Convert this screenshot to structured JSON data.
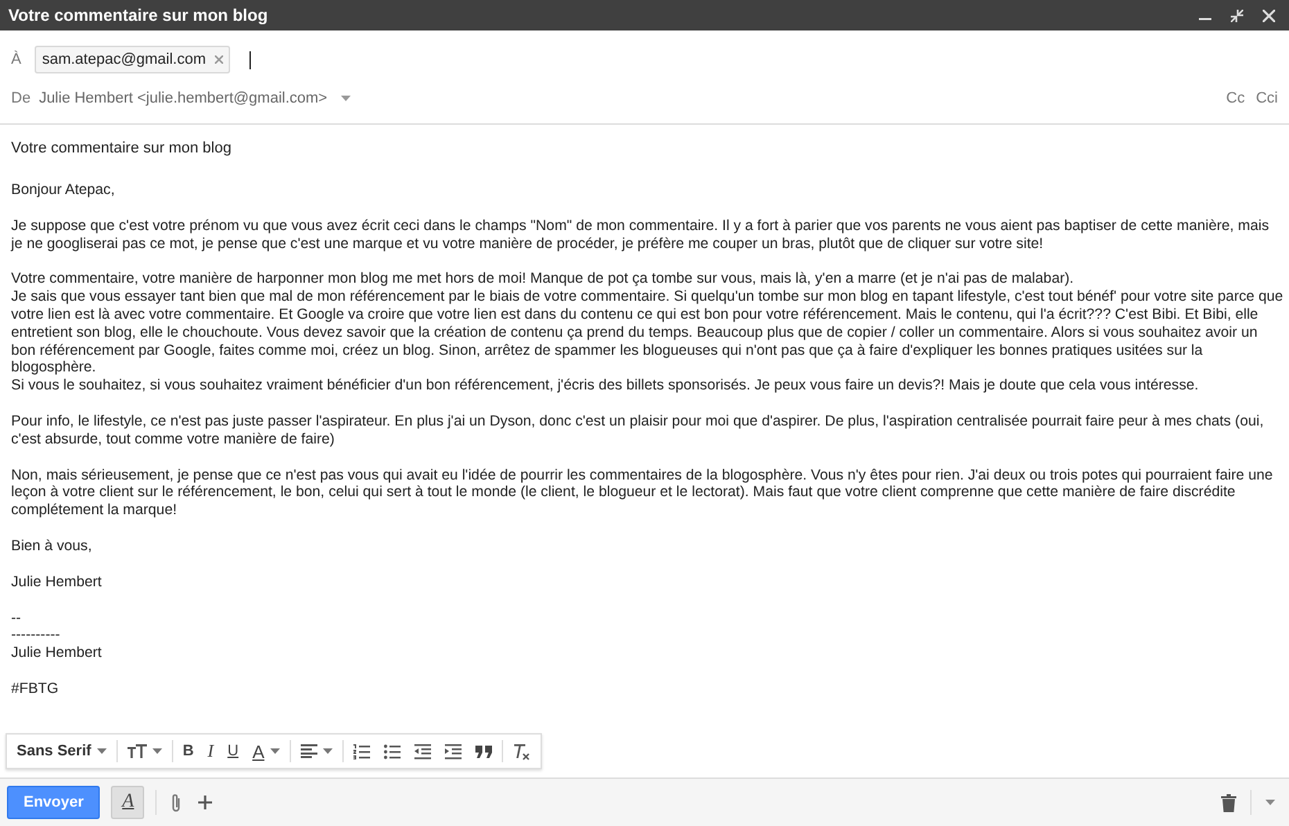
{
  "window": {
    "title": "Votre commentaire sur mon blog"
  },
  "to": {
    "label": "À",
    "recipients": [
      {
        "address": "sam.atepac@gmail.com"
      }
    ]
  },
  "from": {
    "label": "De",
    "value": "Julie Hembert <julie.hembert@gmail.com>"
  },
  "cc_links": [
    "Cc",
    "Cci"
  ],
  "subject": {
    "value": "Votre commentaire sur mon blog"
  },
  "body": [
    [
      "Bonjour Atepac,"
    ],
    [
      "Je suppose que c'est votre prénom vu que vous avez écrit ceci dans le champs \"Nom\" de mon commentaire. Il y a fort à parier que vos parents ne vous aient pas baptiser de cette manière, mais je ne googliserai pas ce mot, je pense que c'est une marque et vu votre manière de procéder, je préfère me couper un bras, plutôt que de cliquer sur votre site!"
    ],
    [
      "Votre commentaire, votre manière de harponner mon blog me met hors de moi! Manque de pot ça tombe sur vous, mais là, y'en a marre (et je n'ai pas de malabar).",
      "Je sais que vous essayer tant bien que mal de mon référencement par le biais de votre commentaire. Si quelqu'un tombe sur mon blog en tapant lifestyle, c'est tout bénéf' pour votre site parce que votre lien est là avec votre commentaire. Et Google va croire que votre lien est dans du contenu ce qui est bon pour votre référencement. Mais le contenu, qui l'a écrit??? C'est Bibi. Et Bibi, elle entretient son blog, elle le chouchoute. Vous devez savoir que la création de contenu ça prend du temps. Beaucoup plus que de copier / coller un commentaire. Alors si vous souhaitez avoir un bon référencement par Google, faites comme moi, créez un blog. Sinon, arrêtez de spammer les blogueuses qui n'ont pas que ça à faire d'expliquer les bonnes pratiques usitées sur la blogosphère.",
      "Si vous le souhaitez, si vous souhaitez vraiment bénéficier d'un bon référencement, j'écris des billets sponsorisés. Je peux vous faire un devis?! Mais je doute que cela vous intéresse."
    ],
    [
      "Pour info, le lifestyle, ce n'est pas juste passer l'aspirateur. En plus j'ai un Dyson, donc c'est un plaisir pour moi que d'aspirer. De plus, l'aspiration centralisée pourrait faire peur à mes chats (oui, c'est absurde, tout comme votre manière de faire)"
    ],
    [
      "Non, mais sérieusement, je pense que ce n'est pas vous qui avait eu l'idée de pourrir les commentaires de la blogosphère. Vous n'y êtes pour rien. J'ai deux ou trois potes qui pourraient faire une leçon à votre client sur le référencement, le bon, celui qui sert à tout le monde (le client, le blogueur et le lectorat). Mais faut que votre client comprenne que cette manière de faire discrédite complétement la marque!"
    ],
    [
      "Bien à vous,"
    ],
    [
      "Julie Hembert"
    ],
    [
      "--",
      "----------",
      "Julie Hembert"
    ],
    [
      "#FBTG"
    ]
  ],
  "format_toolbar": [
    {
      "kind": "select",
      "label": "Sans Serif"
    },
    {
      "kind": "size"
    },
    {
      "kind": "bold",
      "label": "B"
    },
    {
      "kind": "italic",
      "label": "I"
    },
    {
      "kind": "underline",
      "label": "U"
    },
    {
      "kind": "color",
      "label": "A"
    },
    {
      "kind": "align"
    },
    {
      "kind": "numbered"
    },
    {
      "kind": "bulleted"
    },
    {
      "kind": "outdent"
    },
    {
      "kind": "indent"
    },
    {
      "kind": "quote"
    },
    {
      "kind": "clear"
    }
  ],
  "send_button": "Envoyer",
  "format_toggle": {
    "label": "A",
    "selected": true
  }
}
